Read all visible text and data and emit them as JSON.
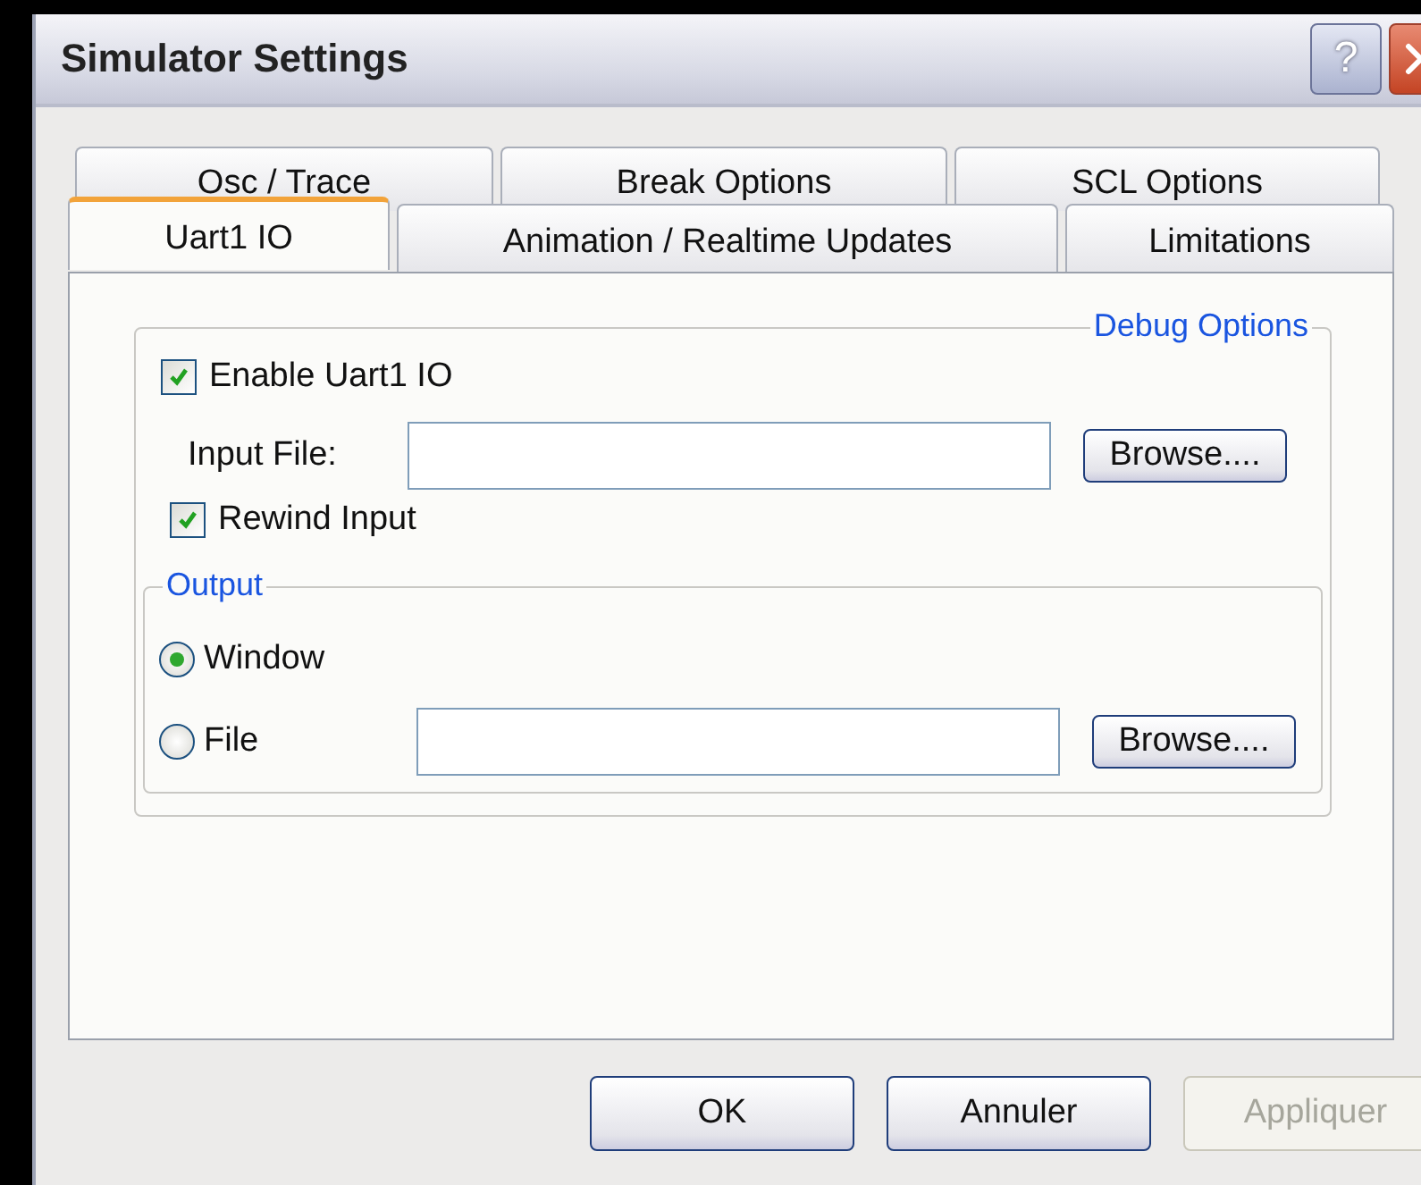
{
  "window": {
    "title": "Simulator Settings",
    "help": "?"
  },
  "tab_rows": [
    [
      {
        "label": "Osc / Trace",
        "selected": false
      },
      {
        "label": "Break Options",
        "selected": false
      },
      {
        "label": "SCL Options",
        "selected": false
      }
    ],
    [
      {
        "label": "Uart1  IO",
        "selected": true
      },
      {
        "label": "Animation / Realtime  Updates",
        "selected": false
      },
      {
        "label": "Limitations",
        "selected": false
      }
    ]
  ],
  "debug_options": {
    "title": "Debug Options",
    "enable": {
      "label": "Enable Uart1 IO",
      "checked": true
    },
    "input_file": {
      "label": "Input  File:",
      "button": "Browse...."
    },
    "rewind": {
      "label": "Rewind Input",
      "checked": true
    },
    "output": {
      "title": "Output",
      "options": [
        {
          "label": "Window",
          "selected": true,
          "kind": "plain"
        },
        {
          "label": "File",
          "selected": false,
          "kind": "file",
          "button": "Browse...."
        }
      ]
    }
  },
  "buttons": [
    {
      "label": "OK",
      "disabled": false
    },
    {
      "label": "Annuler",
      "disabled": false
    },
    {
      "label": "Appliquer",
      "disabled": true
    }
  ]
}
